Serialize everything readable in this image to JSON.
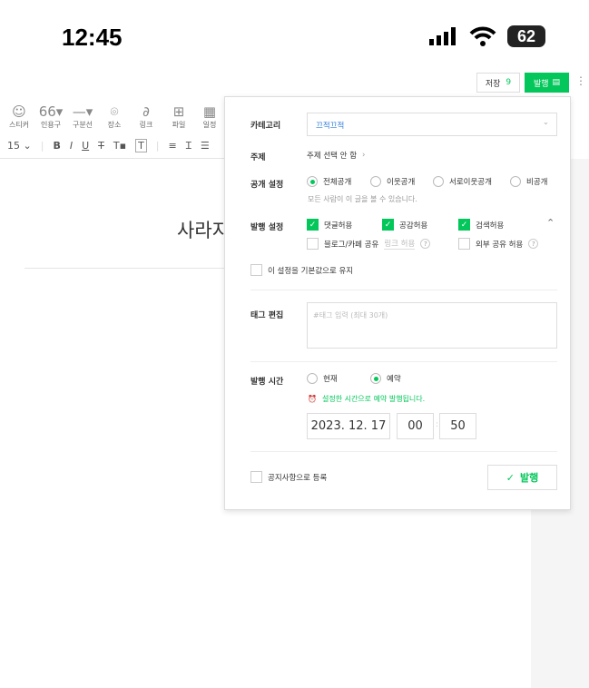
{
  "status_bar": {
    "time": "12:45",
    "battery": "62"
  },
  "header": {
    "save_label": "저장",
    "save_count": "9",
    "publish_label": "발행"
  },
  "toolbar": {
    "items": [
      "스티커",
      "인용구",
      "구분선",
      "장소",
      "링크",
      "파일",
      "일정"
    ],
    "font_size": "15"
  },
  "document": {
    "title": "사라지"
  },
  "panel": {
    "category_label": "카테고리",
    "category_value": "끄적끄적",
    "topic_label": "주제",
    "topic_value": "주제 선택 안 함",
    "visibility_label": "공개 설정",
    "visibility_options": [
      "전체공개",
      "이웃공개",
      "서로이웃공개",
      "비공개"
    ],
    "visibility_selected": 0,
    "visibility_desc": "모든 사람이 이 글을 볼 수 있습니다.",
    "publish_settings_label": "발행 설정",
    "allow_comments": "댓글허용",
    "allow_likes": "공감허용",
    "allow_search": "검색허용",
    "blog_cafe_share": "블로그/카페 공유",
    "link_allow": "링크 허용",
    "external_share": "외부 공유 허용",
    "keep_default": "이 설정을 기본값으로 유지",
    "tag_label": "태그 편집",
    "tag_placeholder": "#태그 입력 (최대 30개)",
    "time_label": "발행 시간",
    "time_now": "현재",
    "time_reserve": "예약",
    "reserve_note": "설정한 시간으로 예약 발행됩니다.",
    "date": "2023. 12. 17",
    "hour": "00",
    "minute": "50",
    "notice_label": "공지사항으로 등록",
    "publish_button": "발행"
  },
  "colors": {
    "accent": "#03c75a"
  }
}
